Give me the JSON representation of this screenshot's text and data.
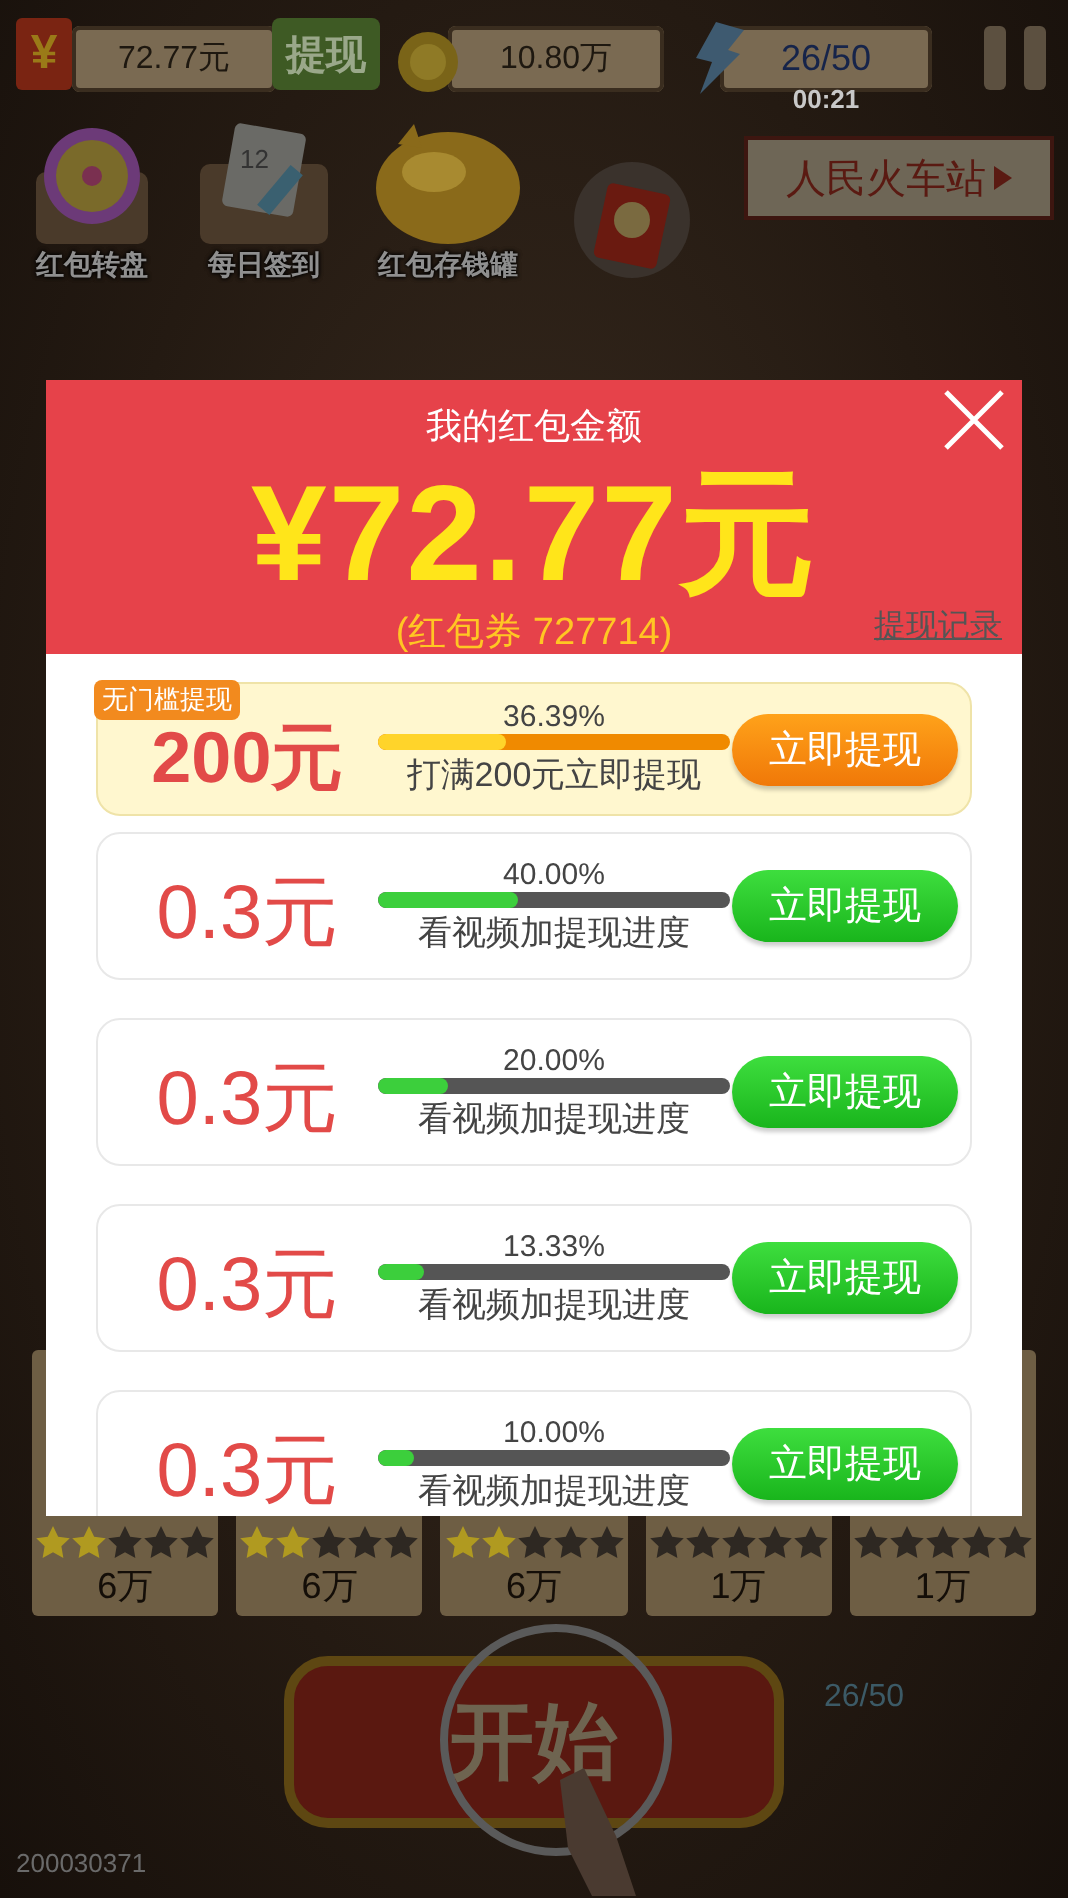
{
  "top_bar": {
    "cash_symbol": "¥",
    "cash": "72.77元",
    "withdraw": "提现",
    "coins": "10.80万",
    "energy": "26/50",
    "timer": "00:21"
  },
  "shortcuts": [
    {
      "kind": "wheel",
      "label": "红包转盘"
    },
    {
      "kind": "calendar",
      "label": "每日签到",
      "date": "12"
    },
    {
      "kind": "piggy",
      "label": "红包存钱罐"
    },
    {
      "kind": "envelope"
    }
  ],
  "location": "人民火车站",
  "modal": {
    "title": "我的红包金额",
    "amount": "¥72.77元",
    "voucher": "(红包券 727714)",
    "history_link": "提现记录",
    "tiers": [
      {
        "kind": "featured",
        "tag": "无门槛提现",
        "amount": "200元",
        "percent": "36.39%",
        "level": 0.3639,
        "caption": "打满200元立即提现",
        "button": "立即提现"
      },
      {
        "kind": "video",
        "amount": "0.3元",
        "percent": "40.00%",
        "level": 0.4,
        "caption": "看视频加提现进度",
        "button": "立即提现"
      },
      {
        "kind": "video",
        "amount": "0.3元",
        "percent": "20.00%",
        "level": 0.2,
        "caption": "看视频加提现进度",
        "button": "立即提现"
      },
      {
        "kind": "video",
        "amount": "0.3元",
        "percent": "13.33%",
        "level": 0.1333,
        "caption": "看视频加提现进度",
        "button": "立即提现"
      },
      {
        "kind": "video",
        "amount": "0.3元",
        "percent": "10.00%",
        "level": 0.1,
        "caption": "看视频加提现进度",
        "button": "立即提现"
      }
    ]
  },
  "level_cards": [
    {
      "stars": 2,
      "reward": "6万"
    },
    {
      "stars": 2,
      "reward": "6万"
    },
    {
      "stars": 2,
      "reward": "6万"
    },
    {
      "stars": 0,
      "reward": "1万"
    },
    {
      "stars": 0,
      "reward": "1万"
    }
  ],
  "start_button": "开始",
  "start_energy": "26/50",
  "build_id": "200030371"
}
